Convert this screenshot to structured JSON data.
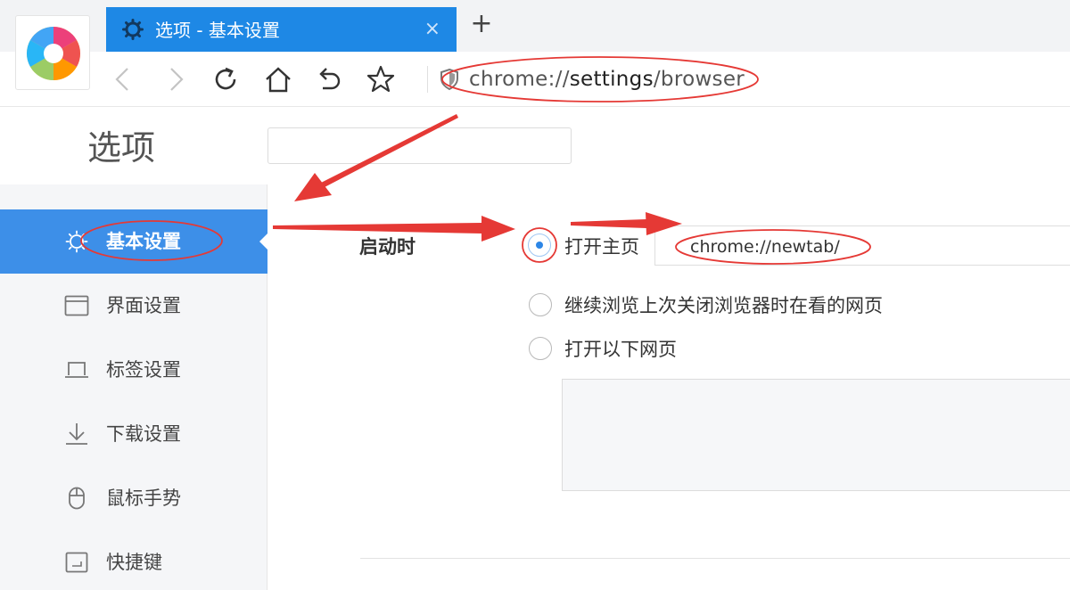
{
  "browser": {
    "tab": {
      "title": "选项 - 基本设置",
      "close": "×"
    },
    "new_tab": "+",
    "address": {
      "prefix": "chrome://",
      "strong": "settings",
      "suffix": "/browser"
    }
  },
  "options": {
    "title": "选项",
    "search": {
      "placeholder": "",
      "value": ""
    }
  },
  "sidebar": {
    "items": [
      {
        "label": "基本设置",
        "icon": "gear-icon",
        "active": true
      },
      {
        "label": "界面设置",
        "icon": "window-icon",
        "active": false
      },
      {
        "label": "标签设置",
        "icon": "laptop-icon",
        "active": false
      },
      {
        "label": "下载设置",
        "icon": "download-icon",
        "active": false
      },
      {
        "label": "鼠标手势",
        "icon": "mouse-icon",
        "active": false
      },
      {
        "label": "快捷键",
        "icon": "keyboard-icon",
        "active": false
      }
    ]
  },
  "startup": {
    "label": "启动时",
    "options": [
      {
        "label": "打开主页",
        "checked": true
      },
      {
        "label": "继续浏览上次关闭浏览器时在看的网页",
        "checked": false
      },
      {
        "label": "打开以下网页",
        "checked": false
      }
    ],
    "homepage_url": "chrome://newtab/"
  },
  "colors": {
    "accent": "#1e88e5",
    "sidebar_active": "#3d8fe8",
    "annotation": "#e53935"
  }
}
